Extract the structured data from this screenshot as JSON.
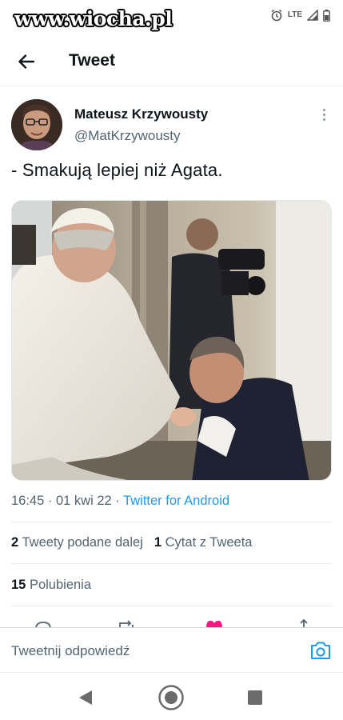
{
  "status_bar": {
    "watermark": "www.wiocha.pl",
    "network": "LTE"
  },
  "header": {
    "title": "Tweet"
  },
  "tweet": {
    "author_name": "Mateusz Krzywousty",
    "author_handle": "@MatKrzywousty",
    "text": "- Smakują lepiej niż Agata.",
    "time": "16:45",
    "date": "01 kwi 22",
    "source": "Twitter for Android"
  },
  "stats": {
    "retweets_count": "2",
    "retweets_label": "Tweety podane dalej",
    "quotes_count": "1",
    "quotes_label": "Cytat z Tweeta",
    "likes_count": "15",
    "likes_label": "Polubienia"
  },
  "reply": {
    "placeholder": "Tweetnij odpowiedź"
  },
  "icons": {
    "back": "arrow-left-icon",
    "more": "vertical-dots-icon",
    "camera": "camera-icon",
    "alarm": "alarm-icon",
    "signal": "signal-icon",
    "battery": "battery-icon"
  },
  "colors": {
    "accent": "#1d9bf0",
    "like": "#f91880",
    "muted": "#536471"
  }
}
